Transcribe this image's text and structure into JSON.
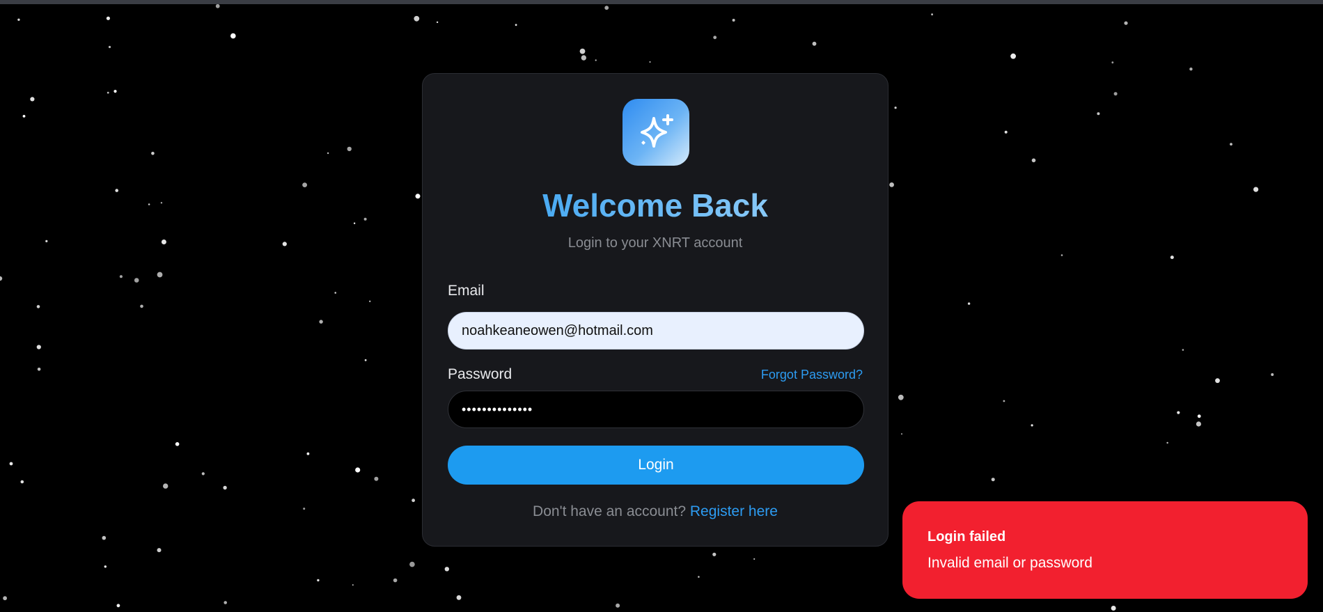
{
  "colors": {
    "background": "#000000",
    "card": "#17181c",
    "accent": "#1d9bf0",
    "link": "#2d9cf2",
    "error": "#f2202f"
  },
  "logo": {
    "icon": "sparkles-icon"
  },
  "login_card": {
    "title": "Welcome Back",
    "subtitle": "Login to your XNRT account",
    "email_label": "Email",
    "email_value": "noahkeaneowen@hotmail.com",
    "password_label": "Password",
    "password_value": "••••••••••••••",
    "forgot_label": "Forgot Password?",
    "login_label": "Login",
    "register_prompt": "Don't have an account?",
    "register_link": "Register here"
  },
  "toast": {
    "title": "Login failed",
    "message": "Invalid email or password"
  }
}
